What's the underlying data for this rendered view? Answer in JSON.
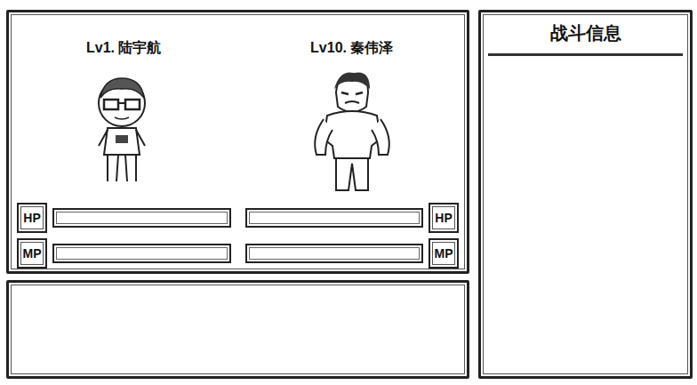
{
  "fighters": [
    {
      "label": "Lv1. 陆宇航",
      "kind": "player",
      "hp": {
        "label": "HP",
        "level": 0
      },
      "mp": {
        "label": "MP",
        "level": 0
      }
    },
    {
      "label": "Lv10. 秦伟泽",
      "kind": "enemy",
      "hp": {
        "label": "HP",
        "level": 0
      },
      "mp": {
        "label": "MP",
        "level": 0
      }
    }
  ],
  "info_panel": {
    "title": "战斗信息"
  }
}
